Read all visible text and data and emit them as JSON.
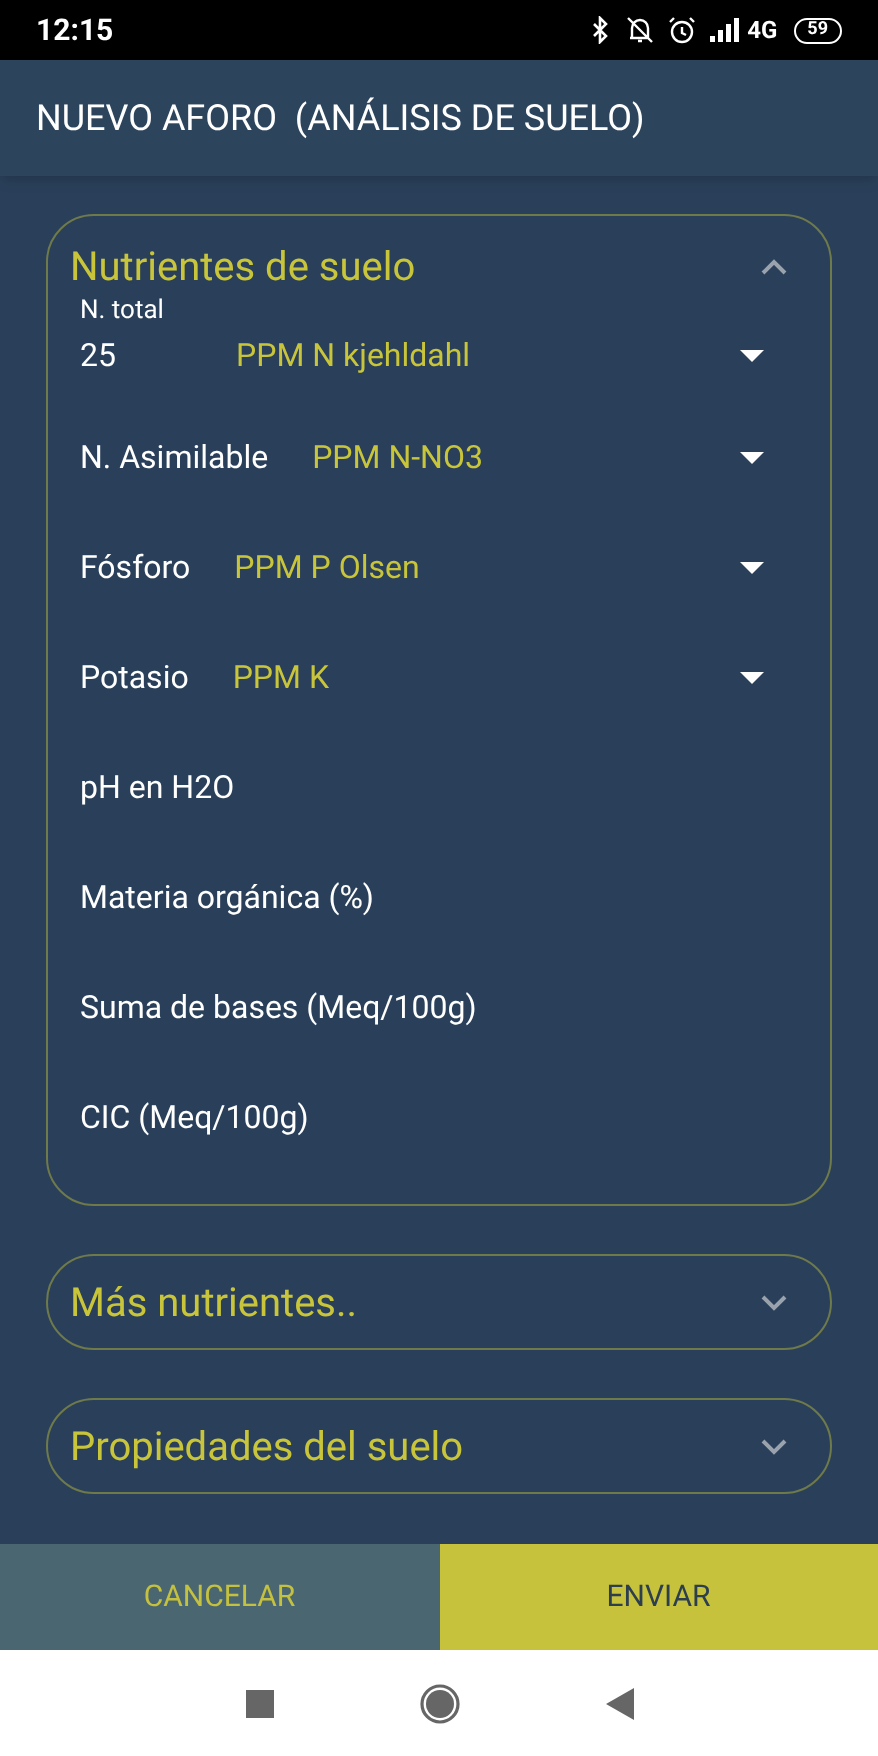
{
  "status_bar": {
    "time": "12:15",
    "network": "4G",
    "battery": "59"
  },
  "header": {
    "title": "NUEVO AFORO  (ANÁLISIS DE SUELO)"
  },
  "sections": [
    {
      "title": "Nutrientes de suelo",
      "expanded": true,
      "fields": [
        {
          "kind": "unit",
          "label": "N. total",
          "value": "25",
          "unit": "PPM N kjehldahl"
        },
        {
          "kind": "unit",
          "label": "N. Asimilable",
          "unit": "PPM N-NO3"
        },
        {
          "kind": "unit",
          "label": "Fósforo",
          "unit": "PPM P Olsen"
        },
        {
          "kind": "unit",
          "label": "Potasio",
          "unit": "PPM K"
        },
        {
          "kind": "text",
          "placeholder": "pH en H2O"
        },
        {
          "kind": "text",
          "placeholder": "Materia orgánica (%)"
        },
        {
          "kind": "text",
          "placeholder": "Suma de bases (Meq/100g)"
        },
        {
          "kind": "text",
          "placeholder": "CIC (Meq/100g)"
        }
      ]
    },
    {
      "title": "Más nutrientes..",
      "expanded": false
    },
    {
      "title": "Propiedades del suelo",
      "expanded": false
    }
  ],
  "buttons": [
    {
      "kind": "secondary",
      "label": "CANCELAR"
    },
    {
      "kind": "primary",
      "label": "ENVIAR"
    }
  ]
}
